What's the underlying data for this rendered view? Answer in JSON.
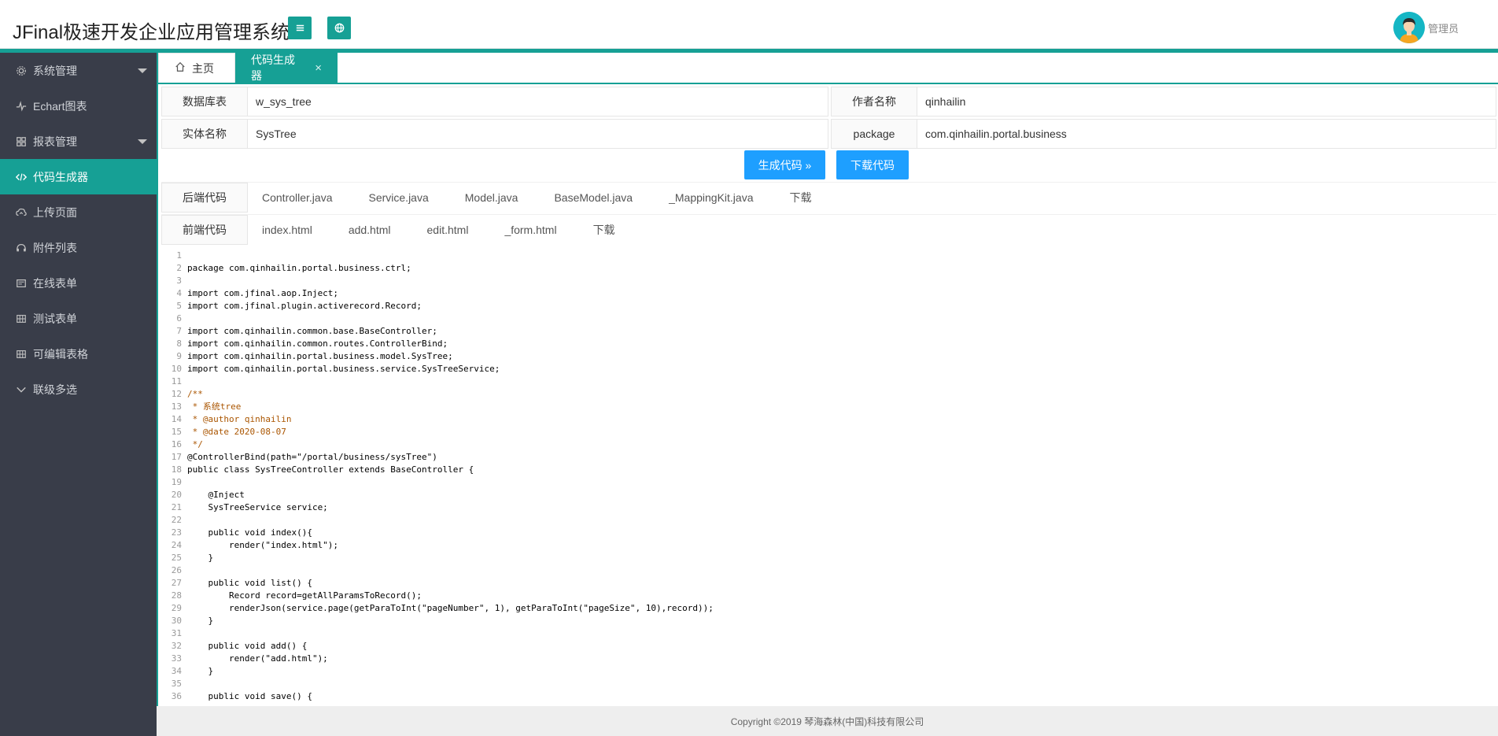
{
  "header": {
    "title": "JFinal极速开发企业应用管理系统",
    "user_name": "管理员"
  },
  "sidebar": {
    "items": [
      {
        "label": "系统管理",
        "icon": "gear-icon",
        "arrow": true
      },
      {
        "label": "Echart图表",
        "icon": "pulse-icon",
        "arrow": false
      },
      {
        "label": "报表管理",
        "icon": "grid-icon",
        "arrow": true
      },
      {
        "label": "代码生成器",
        "icon": "code-icon",
        "arrow": false,
        "active": true
      },
      {
        "label": "上传页面",
        "icon": "cloud-upload-icon",
        "arrow": false
      },
      {
        "label": "附件列表",
        "icon": "headset-icon",
        "arrow": false
      },
      {
        "label": "在线表单",
        "icon": "form-icon",
        "arrow": false
      },
      {
        "label": "测试表单",
        "icon": "table-icon",
        "arrow": false
      },
      {
        "label": "可编辑表格",
        "icon": "table-icon",
        "arrow": false
      },
      {
        "label": "联级多选",
        "icon": "chevron-down-icon",
        "arrow": false
      }
    ]
  },
  "tabs": {
    "home": "主页",
    "active": "代码生成器",
    "close": "×"
  },
  "form": {
    "db_table_label": "数据库表",
    "db_table_value": "w_sys_tree",
    "author_label": "作者名称",
    "author_value": "qinhailin",
    "entity_label": "实体名称",
    "entity_value": "SysTree",
    "package_label": "package",
    "package_value": "com.qinhailin.portal.business"
  },
  "buttons": {
    "generate": "生成代码 »",
    "download": "下载代码"
  },
  "backend": {
    "label": "后端代码",
    "items": [
      "Controller.java",
      "Service.java",
      "Model.java",
      "BaseModel.java",
      "_MappingKit.java",
      "下载"
    ]
  },
  "frontend": {
    "label": "前端代码",
    "items": [
      "index.html",
      "add.html",
      "edit.html",
      "_form.html",
      "下载"
    ]
  },
  "code_lines": [
    "",
    "package com.qinhailin.portal.business.ctrl;",
    "",
    "import com.jfinal.aop.Inject;",
    "import com.jfinal.plugin.activerecord.Record;",
    "",
    "import com.qinhailin.common.base.BaseController;",
    "import com.qinhailin.common.routes.ControllerBind;",
    "import com.qinhailin.portal.business.model.SysTree;",
    "import com.qinhailin.portal.business.service.SysTreeService;",
    "",
    "/**",
    " * 系统tree",
    " * @author qinhailin",
    " * @date 2020-08-07",
    " */",
    "@ControllerBind(path=\"/portal/business/sysTree\")",
    "public class SysTreeController extends BaseController {",
    "",
    "    @Inject",
    "    SysTreeService service;",
    "",
    "    public void index(){",
    "        render(\"index.html\");",
    "    }",
    "",
    "    public void list() {",
    "        Record record=getAllParamsToRecord();",
    "        renderJson(service.page(getParaToInt(\"pageNumber\", 1), getParaToInt(\"pageSize\", 10),record));",
    "    }",
    "",
    "    public void add() {",
    "        render(\"add.html\");",
    "    }",
    "",
    "    public void save() {"
  ],
  "footer": "Copyright ©2019 琴海森林(中国)科技有限公司",
  "colors": {
    "accent": "#16a095",
    "button": "#1e9fff",
    "sidebar": "#393d49"
  }
}
